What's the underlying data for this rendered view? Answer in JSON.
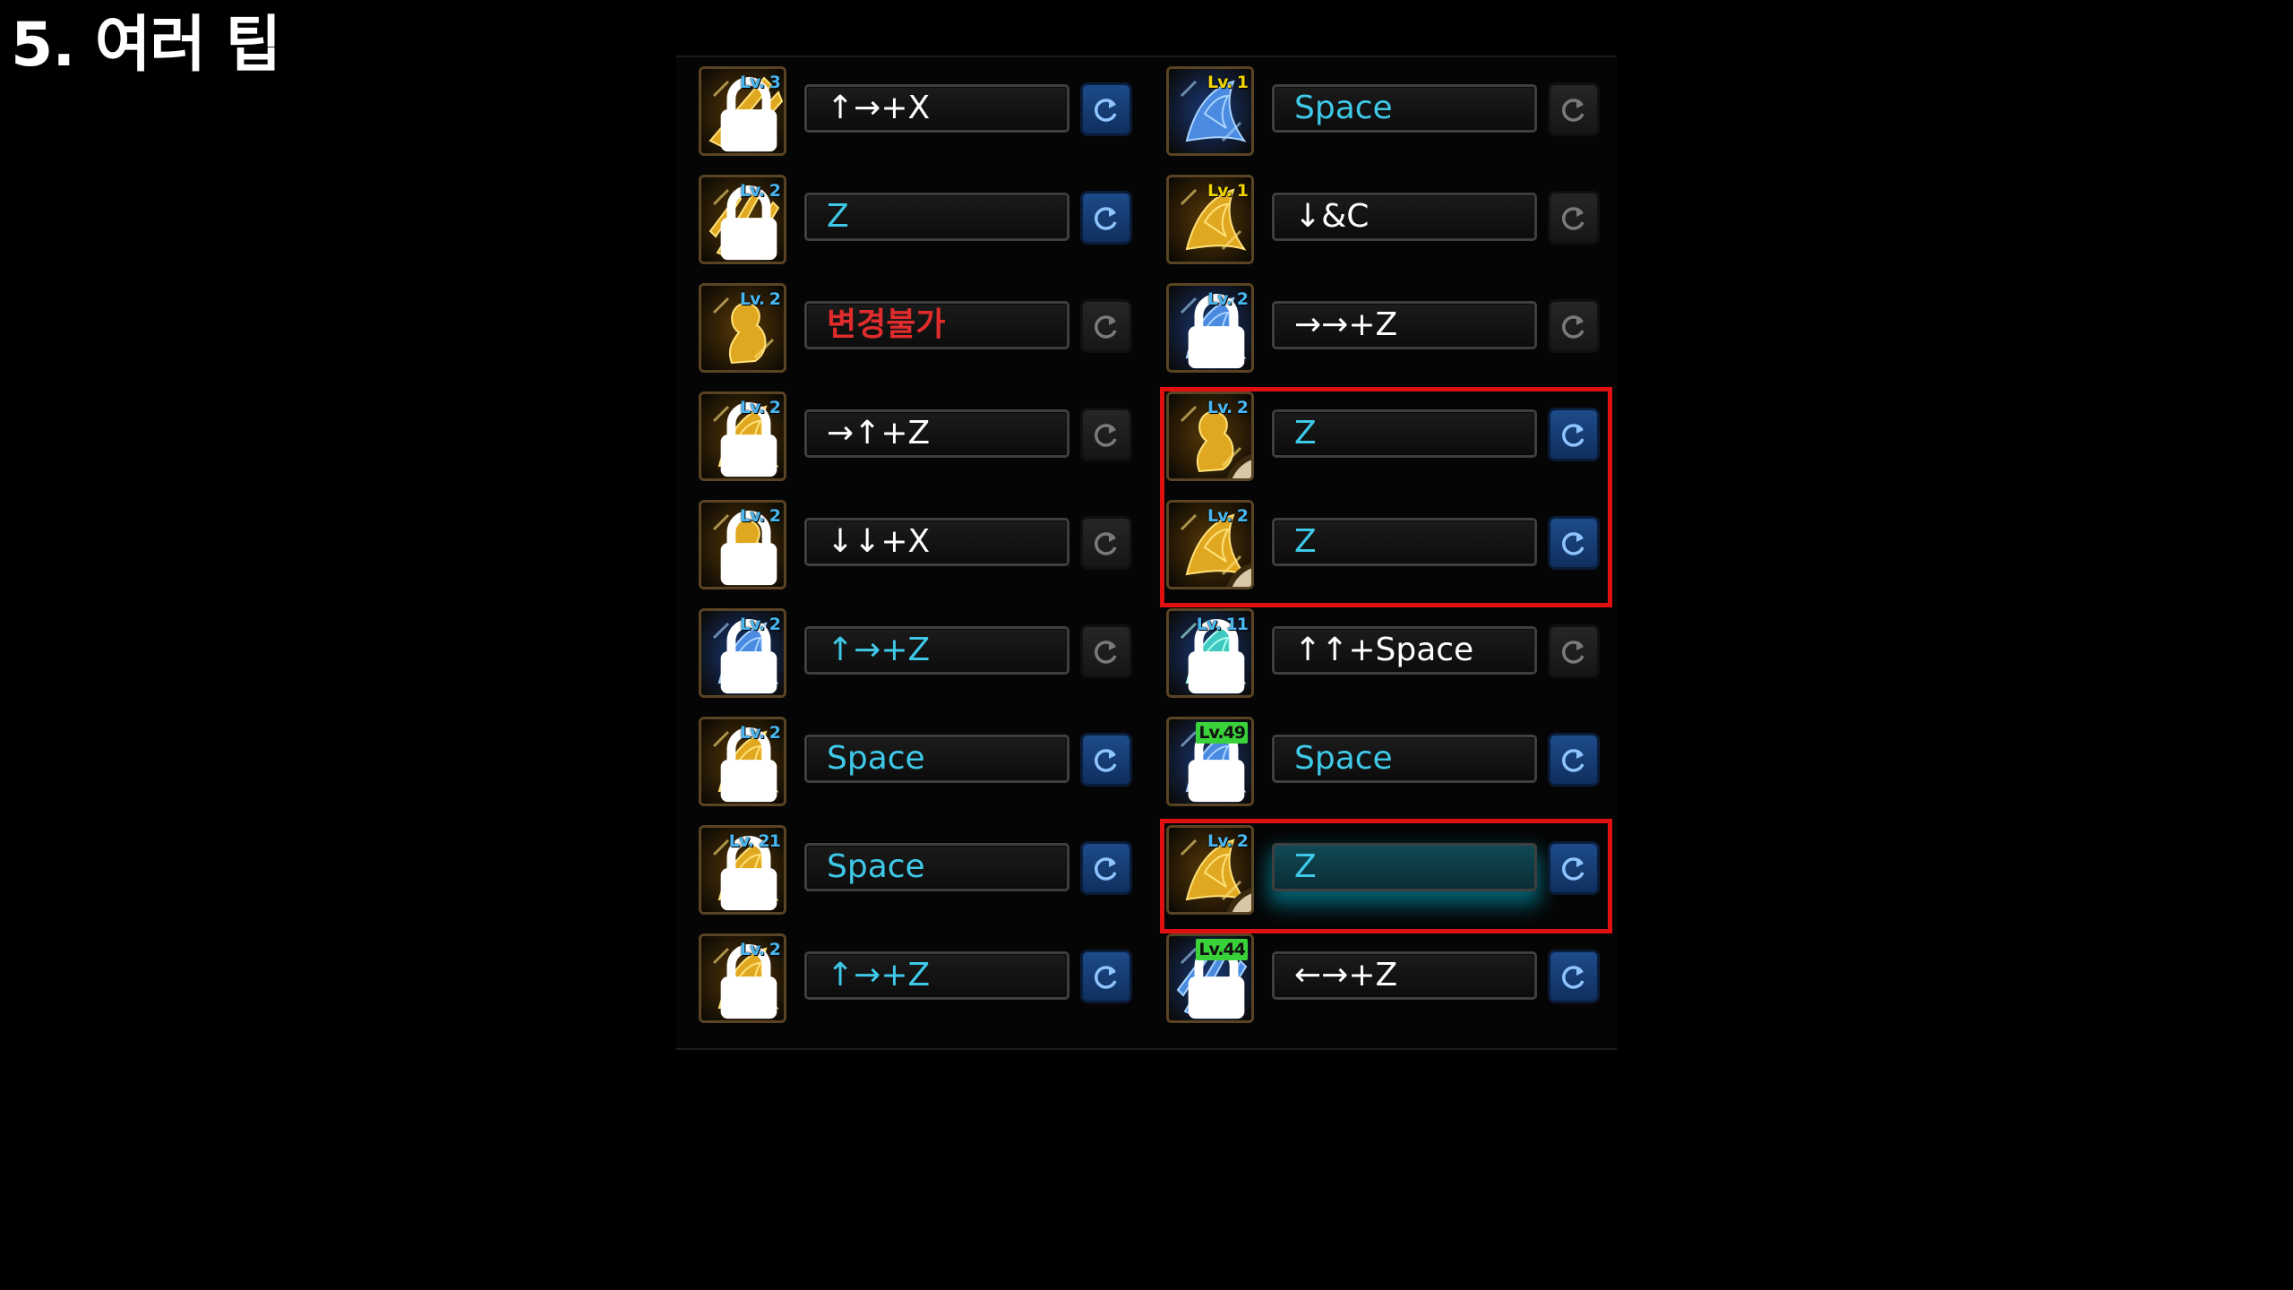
{
  "title": "5. 여러 팁",
  "colors": {
    "cyan_text": "#3fc9e8",
    "white_text": "#ffffff",
    "red_text": "#e02c2c",
    "level_blue": "#49b6f0",
    "level_gold": "#f0d400",
    "level_green": "#3ad23a",
    "highlight_border": "#e01010"
  },
  "skills_left": [
    {
      "level": "Lv. 3",
      "level_style": "blue",
      "locked": true,
      "icon": "golden-slash-icon",
      "command": "↑→+X",
      "text_color": "white",
      "reset_active": true,
      "cooldown": false
    },
    {
      "level": "Lv. 2",
      "level_style": "blue",
      "locked": true,
      "icon": "golden-claw-icon",
      "command": "Z",
      "text_color": "cyan",
      "reset_active": true,
      "cooldown": false
    },
    {
      "level": "Lv. 2",
      "level_style": "blue",
      "locked": false,
      "icon": "golden-warrior-icon",
      "command": "변경불가",
      "text_color": "red",
      "reset_active": false,
      "cooldown": false
    },
    {
      "level": "Lv. 2",
      "level_style": "blue",
      "locked": true,
      "icon": "golden-uppercut-icon",
      "command": "→↑+Z",
      "text_color": "white",
      "reset_active": false,
      "cooldown": false
    },
    {
      "level": "Lv. 2",
      "level_style": "blue",
      "locked": true,
      "icon": "golden-fist-icon",
      "command": "↓↓+X",
      "text_color": "white",
      "reset_active": false,
      "cooldown": false
    },
    {
      "level": "Lv. 2",
      "level_style": "blue",
      "locked": true,
      "icon": "blue-wave-icon",
      "command": "↑→+Z",
      "text_color": "cyan",
      "reset_active": false,
      "cooldown": false
    },
    {
      "level": "Lv. 2",
      "level_style": "blue",
      "locked": true,
      "icon": "golden-kick-icon",
      "command": "Space",
      "text_color": "cyan",
      "reset_active": true,
      "cooldown": false
    },
    {
      "level": "Lv. 21",
      "level_style": "blue",
      "locked": true,
      "icon": "golden-spin-icon",
      "command": "Space",
      "text_color": "cyan",
      "reset_active": true,
      "cooldown": false
    },
    {
      "level": "Lv. 2",
      "level_style": "blue",
      "locked": true,
      "icon": "golden-flame-icon",
      "command": "↑→+Z",
      "text_color": "cyan",
      "reset_active": true,
      "cooldown": false
    }
  ],
  "skills_right": [
    {
      "level": "Lv. 1",
      "level_style": "gold",
      "locked": false,
      "icon": "blue-beast-icon",
      "command": "Space",
      "text_color": "cyan",
      "reset_active": false,
      "cooldown": false
    },
    {
      "level": "Lv. 1",
      "level_style": "gold",
      "locked": false,
      "icon": "golden-runner-icon",
      "command": "↓&C",
      "text_color": "white",
      "reset_active": false,
      "cooldown": false
    },
    {
      "level": "Lv. 2",
      "level_style": "blue",
      "locked": true,
      "icon": "blue-dash-icon",
      "command": "→→+Z",
      "text_color": "white",
      "reset_active": false,
      "cooldown": false
    },
    {
      "level": "Lv. 2",
      "level_style": "blue",
      "locked": false,
      "icon": "golden-pillar-icon",
      "command": "Z",
      "text_color": "cyan",
      "reset_active": true,
      "cooldown": true
    },
    {
      "level": "Lv. 2",
      "level_style": "blue",
      "locked": false,
      "icon": "golden-strike-icon",
      "command": "Z",
      "text_color": "cyan",
      "reset_active": true,
      "cooldown": true
    },
    {
      "level": "Lv. 11",
      "level_style": "blue",
      "locked": true,
      "icon": "teal-cat-icon",
      "command": "↑↑+Space",
      "text_color": "white",
      "reset_active": false,
      "cooldown": false
    },
    {
      "level": "Lv.49",
      "level_style": "green",
      "locked": true,
      "icon": "blue-spike-icon",
      "command": "Space",
      "text_color": "cyan",
      "reset_active": true,
      "cooldown": false
    },
    {
      "level": "Lv. 2",
      "level_style": "blue",
      "locked": false,
      "icon": "golden-burst-icon",
      "command": "Z",
      "text_color": "cyan",
      "reset_active": true,
      "cooldown": true,
      "highlight": true
    },
    {
      "level": "Lv.44",
      "level_style": "green",
      "locked": true,
      "icon": "blue-claw-icon",
      "command": "←→+Z",
      "text_color": "white",
      "reset_active": true,
      "cooldown": false
    }
  ]
}
